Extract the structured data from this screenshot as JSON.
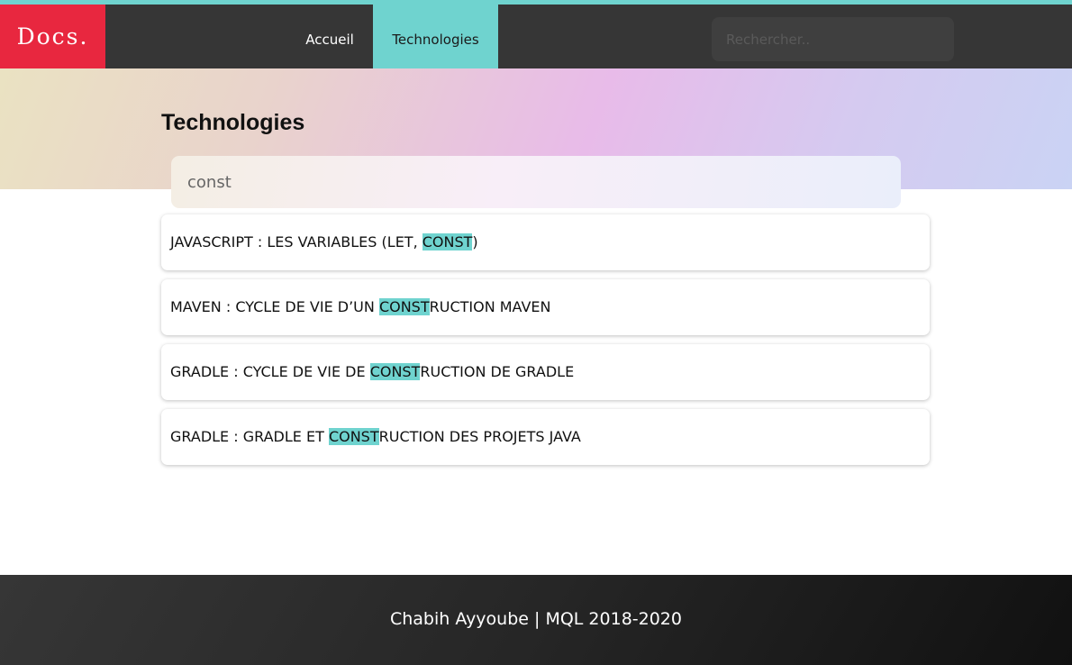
{
  "colors": {
    "accent": "#6fd3cf",
    "logo_bg": "#e8273f",
    "navbar_bg": "#363636"
  },
  "header": {
    "logo": "Docs.",
    "nav": [
      {
        "label": "Accueil",
        "active": false
      },
      {
        "label": "Technologies",
        "active": true
      }
    ],
    "search": {
      "placeholder": "Rechercher..",
      "value": ""
    }
  },
  "main": {
    "title": "Technologies",
    "filter": {
      "value": "const"
    },
    "results": [
      {
        "prefix": "JAVASCRIPT : LES VARIABLES (LET, ",
        "match": "CONST",
        "suffix": ")"
      },
      {
        "prefix": "MAVEN : CYCLE DE VIE D’UN ",
        "match": "CONST",
        "suffix": "RUCTION MAVEN"
      },
      {
        "prefix": "GRADLE : CYCLE DE VIE DE ",
        "match": "CONST",
        "suffix": "RUCTION DE GRADLE"
      },
      {
        "prefix": "GRADLE : GRADLE ET ",
        "match": "CONST",
        "suffix": "RUCTION DES PROJETS JAVA"
      }
    ]
  },
  "footer": {
    "text": "Chabih Ayyoube | MQL 2018-2020"
  }
}
